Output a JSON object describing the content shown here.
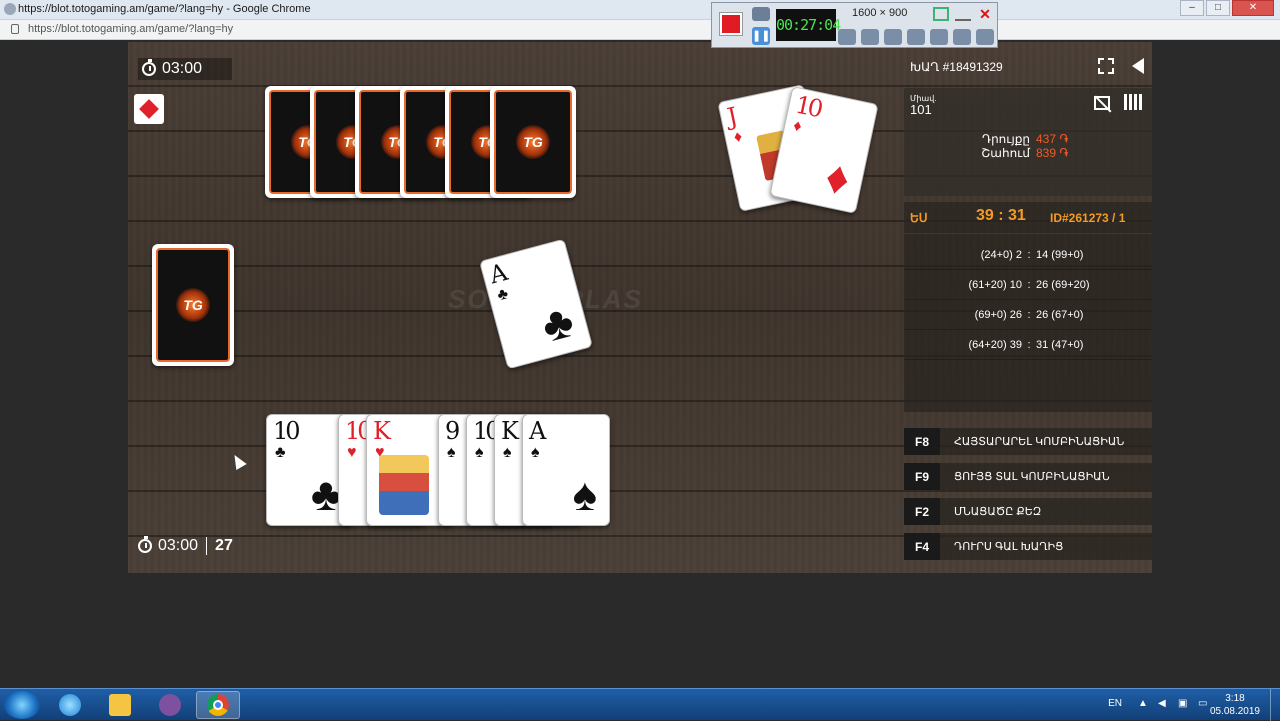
{
  "browser": {
    "title": "https://blot.totogaming.am/game/?lang=hy - Google Chrome",
    "url": "https://blot.totogaming.am/game/?lang=hy"
  },
  "recorder": {
    "time": "00:27:04",
    "resolution": "1600 × 900"
  },
  "game": {
    "timer_top": "03:00",
    "timer_bottom": "03:00",
    "bottom_count": "27",
    "trump_suit": "diamond",
    "logo_text": "TG",
    "watermark": "SOSIAL PLAS",
    "table_card": {
      "rank": "A",
      "suit": "♣",
      "color": "black"
    },
    "partner_cards": [
      {
        "rank": "J",
        "suit": "♦",
        "color": "red"
      },
      {
        "rank": "10",
        "suit": "♦",
        "color": "red"
      }
    ],
    "hand": [
      {
        "rank": "10",
        "suit": "♣",
        "color": "black"
      },
      {
        "rank": "10",
        "suit": "♥",
        "color": "red"
      },
      {
        "rank": "K",
        "suit": "♥",
        "color": "red"
      },
      {
        "rank": "9",
        "suit": "♠",
        "color": "black"
      },
      {
        "rank": "10",
        "suit": "♠",
        "color": "black"
      },
      {
        "rank": "K",
        "suit": "♠",
        "color": "black"
      },
      {
        "rank": "A",
        "suit": "♠",
        "color": "black"
      }
    ]
  },
  "panel": {
    "game_id": "ԽԱՂ #18491329",
    "level_label": "Միավ.",
    "level_value": "101",
    "stats": [
      {
        "label": "Դրույքը",
        "value": "437 ֏"
      },
      {
        "label": "Շահում",
        "value": "839 ֏"
      }
    ],
    "score": {
      "we": "ԵՍ",
      "total": "39 : 31",
      "id": "ID#261273 / 1",
      "rounds": [
        {
          "left": "(24+0) 2",
          "right": "14 (99+0)"
        },
        {
          "left": "(61+20) 10",
          "right": "26 (69+20)"
        },
        {
          "left": "(69+0) 26",
          "right": "26 (67+0)"
        },
        {
          "left": "(64+20) 39",
          "right": "31 (47+0)"
        }
      ]
    },
    "shortcuts": [
      {
        "key": "F8",
        "label": "ՀԱՅՏԱՐԱՐԵԼ ԿՈՄԲԻՆԱՑԻԱՆ"
      },
      {
        "key": "F9",
        "label": "ՑՈՒՅՑ ՏԱԼ ԿՈՄԲԻՆԱՑԻԱՆ"
      },
      {
        "key": "F2",
        "label": "ՄՆԱՑԱԾԸ ՔԵԶ"
      },
      {
        "key": "F4",
        "label": "ԴՈՒՐՍ ԳԱԼ ԽԱՂԻՑ"
      }
    ]
  },
  "taskbar": {
    "lang": "EN",
    "time": "3:18",
    "date": "05.08.2019"
  }
}
